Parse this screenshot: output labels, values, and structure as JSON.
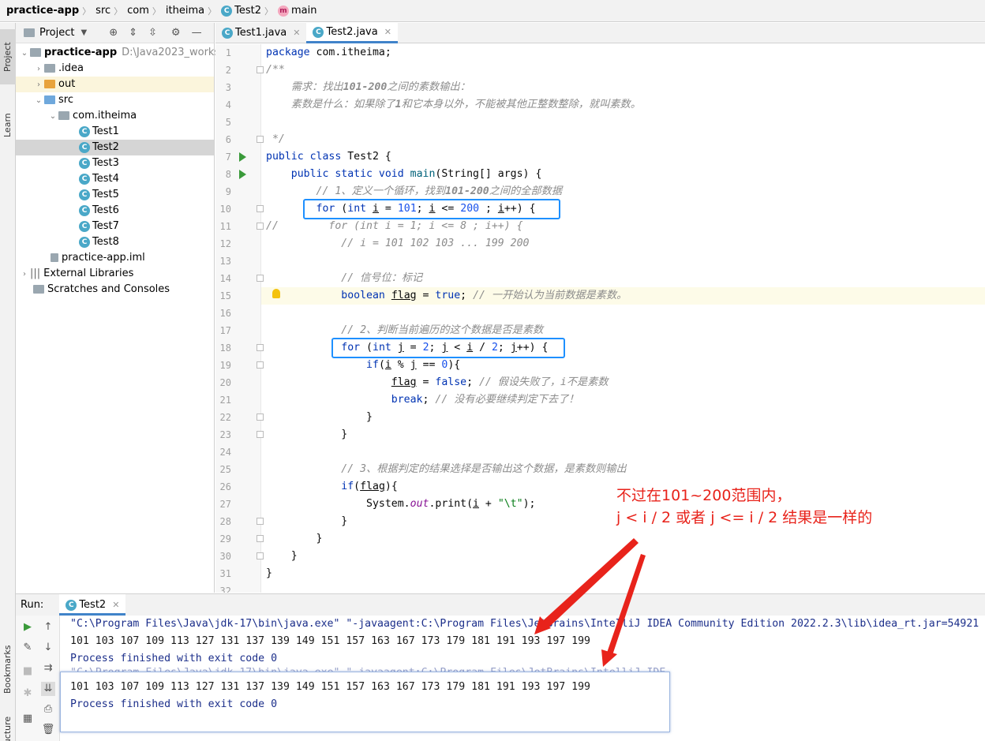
{
  "breadcrumb": {
    "project": "practice-app",
    "items": [
      "src",
      "com",
      "itheima"
    ],
    "class": "Test2",
    "method": "main"
  },
  "side_tabs": {
    "project": "Project",
    "learn": "Learn",
    "bookmarks": "Bookmarks",
    "structure": "Structure"
  },
  "project_panel": {
    "title": "Project",
    "root": "practice-app",
    "root_path": "D:\\Java2023_workspac",
    "idea": ".idea",
    "out": "out",
    "src": "src",
    "package": "com.itheima",
    "classes": [
      "Test1",
      "Test2",
      "Test3",
      "Test4",
      "Test5",
      "Test6",
      "Test7",
      "Test8"
    ],
    "iml": "practice-app.iml",
    "external": "External Libraries",
    "scratches": "Scratches and Consoles"
  },
  "editor_tabs": [
    "Test1.java",
    "Test2.java"
  ],
  "line_numbers": [
    "1",
    "2",
    "3",
    "4",
    "5",
    "6",
    "7",
    "8",
    "9",
    "10",
    "11",
    "12",
    "13",
    "14",
    "15",
    "16",
    "17",
    "18",
    "19",
    "20",
    "21",
    "22",
    "23",
    "24",
    "25",
    "26",
    "27",
    "28",
    "29",
    "30",
    "31",
    "32"
  ],
  "annotation": {
    "line1": "不过在101~200范围内，",
    "line2": "j < i / 2 或者 j <= i / 2 结果是一样的"
  },
  "run_panel": {
    "label": "Run:",
    "tab": "Test2",
    "command": "\"C:\\Program Files\\Java\\jdk-17\\bin\\java.exe\" \"-javaagent:C:\\Program Files\\JetBrains\\IntelliJ IDEA Community Edition 2022.2.3\\lib\\idea_rt.jar=54921",
    "output": "101 103 107 109 113 127 131 137 139 149 151 157 163 167 173 179 181 191 193 197 199",
    "finished": "Process finished with exit code 0",
    "command_partial": "\"C:\\Program Files\\Java\\jdk-17\\bin\\java.exe\" \"-javaagent:C:\\Program Files\\JetBrains\\IntelliJ IDE"
  },
  "colors": {
    "keyword": "#0033b3",
    "number": "#1750eb",
    "comment": "#8c8c8c",
    "annotation_red": "#e8231b",
    "highlight_box": "#1e90ff"
  }
}
